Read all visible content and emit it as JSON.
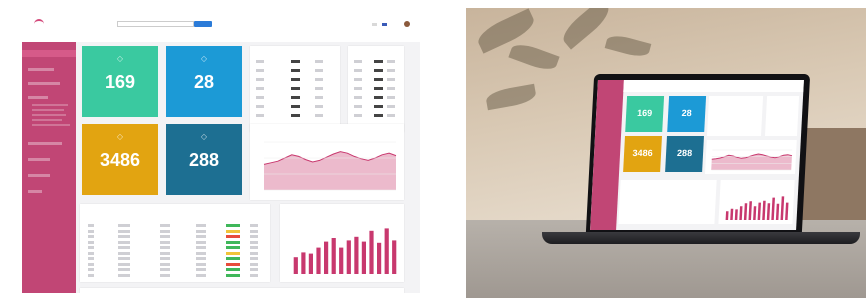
{
  "colors": {
    "sidebar": "#c14675",
    "teal": "#3ac9a0",
    "blue": "#1c9ad6",
    "gold": "#e2a411",
    "darkblue": "#1d6f92",
    "accent": "#c8386e"
  },
  "tiles": [
    {
      "value": "169",
      "label": "",
      "color": "#3ac9a0",
      "icon": "box-icon"
    },
    {
      "value": "28",
      "label": "",
      "color": "#1c9ad6",
      "icon": "bag-icon"
    },
    {
      "value": "3486",
      "label": "",
      "color": "#e2a411",
      "icon": "leaf-icon"
    },
    {
      "value": "288",
      "label": "",
      "color": "#1d6f92",
      "icon": "recycle-icon"
    }
  ],
  "chart_data": [
    {
      "type": "area",
      "title": "",
      "x": [
        1,
        2,
        3,
        4,
        5,
        6,
        7,
        8,
        9,
        10,
        11,
        12,
        13,
        14,
        15,
        16,
        17,
        18,
        19,
        20
      ],
      "series": [
        {
          "values": [
            32,
            34,
            36,
            40,
            44,
            42,
            38,
            35,
            37,
            41,
            45,
            48,
            46,
            42,
            39,
            37,
            40,
            44,
            46,
            43
          ]
        }
      ],
      "ylim": [
        0,
        60
      ]
    },
    {
      "type": "bar",
      "title": "",
      "categories": [
        "1",
        "2",
        "3",
        "4",
        "5",
        "6",
        "7",
        "8",
        "9",
        "10",
        "11",
        "12",
        "13",
        "14"
      ],
      "values": [
        14,
        18,
        17,
        22,
        27,
        30,
        22,
        28,
        31,
        27,
        36,
        26,
        38,
        28
      ],
      "ylim": [
        0,
        45
      ]
    }
  ],
  "laptop_tiles": [
    {
      "value": "169",
      "color": "#3ac9a0"
    },
    {
      "value": "28",
      "color": "#1c9ad6"
    },
    {
      "value": "3486",
      "color": "#e2a411"
    },
    {
      "value": "288",
      "color": "#1d6f92"
    }
  ]
}
